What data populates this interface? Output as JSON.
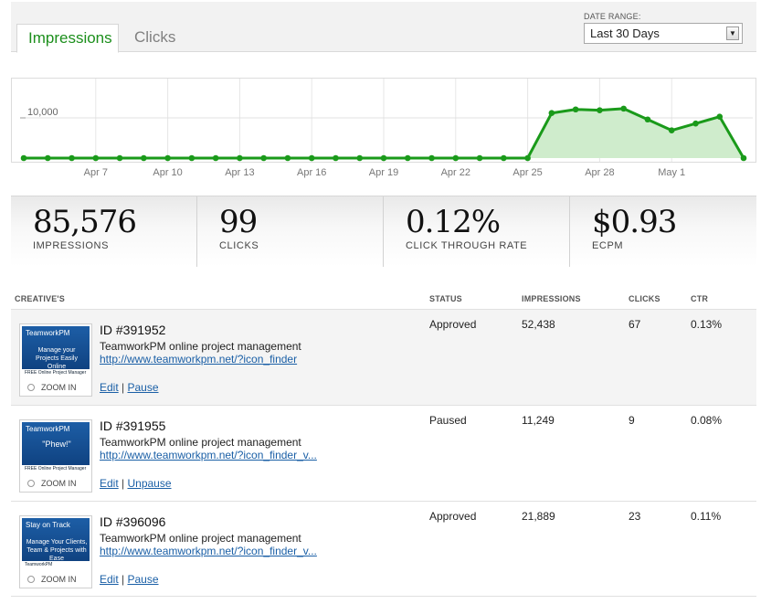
{
  "tabs": [
    {
      "label": "Impressions",
      "active": true
    },
    {
      "label": "Clicks",
      "active": false
    }
  ],
  "date_range": {
    "label": "DATE RANGE:",
    "selected": "Last 30 Days"
  },
  "chart_data": {
    "type": "area",
    "x": [
      "Apr 4",
      "Apr 5",
      "Apr 6",
      "Apr 7",
      "Apr 8",
      "Apr 9",
      "Apr 10",
      "Apr 11",
      "Apr 12",
      "Apr 13",
      "Apr 14",
      "Apr 15",
      "Apr 16",
      "Apr 17",
      "Apr 18",
      "Apr 19",
      "Apr 20",
      "Apr 21",
      "Apr 22",
      "Apr 23",
      "Apr 24",
      "Apr 25",
      "Apr 26",
      "Apr 27",
      "Apr 28",
      "Apr 29",
      "Apr 30",
      "May 1",
      "May 2",
      "May 3",
      "May 4"
    ],
    "tick_labels": [
      "Apr 7",
      "Apr 10",
      "Apr 13",
      "Apr 16",
      "Apr 19",
      "Apr 22",
      "Apr 25",
      "Apr 28",
      "May 1"
    ],
    "values": [
      0,
      0,
      0,
      0,
      0,
      0,
      0,
      0,
      0,
      0,
      0,
      0,
      0,
      0,
      0,
      0,
      0,
      0,
      0,
      0,
      0,
      0,
      11200,
      12100,
      11900,
      12300,
      9600,
      6900,
      8600,
      10300,
      0
    ],
    "y_tick": "10,000",
    "ylim": [
      0,
      20000
    ],
    "colors": {
      "line": "#1a9a1a",
      "fill": "#cfeccc"
    },
    "grid": true
  },
  "stats": [
    {
      "value": "85,576",
      "label": "IMPRESSIONS"
    },
    {
      "value": "99",
      "label": "CLICKS"
    },
    {
      "value": "0.12%",
      "label": "CLICK THROUGH RATE"
    },
    {
      "value": "$0.93",
      "label": "ECPM"
    }
  ],
  "table": {
    "headers": {
      "creatives": "CREATIVE'S",
      "status": "STATUS",
      "impressions": "IMPRESSIONS",
      "clicks": "CLICKS",
      "ctr": "CTR"
    },
    "zoom_label": "ZOOM IN",
    "rows": [
      {
        "id": "ID #391952",
        "desc": "TeamworkPM online project management",
        "url": "http://www.teamworkpm.net/?icon_finder",
        "edit": "Edit",
        "toggle": "Pause",
        "status": "Approved",
        "impressions": "52,438",
        "clicks": "67",
        "ctr": "0.13%",
        "thumb": {
          "brand": "TeamworkPM",
          "tag": "Manage your Projects Easily Online",
          "foot": "FREE Online Project Manager"
        }
      },
      {
        "id": "ID #391955",
        "desc": "TeamworkPM online project management",
        "url": "http://www.teamworkpm.net/?icon_finder_v...",
        "edit": "Edit",
        "toggle": "Unpause",
        "status": "Paused",
        "impressions": "11,249",
        "clicks": "9",
        "ctr": "0.08%",
        "thumb": {
          "brand": "TeamworkPM",
          "tag": "\"Phew!\"",
          "foot": "FREE Online Project Manager"
        }
      },
      {
        "id": "ID #396096",
        "desc": "TeamworkPM online project management",
        "url": "http://www.teamworkpm.net/?icon_finder_v...",
        "edit": "Edit",
        "toggle": "Pause",
        "status": "Approved",
        "impressions": "21,889",
        "clicks": "23",
        "ctr": "0.11%",
        "thumb": {
          "brand": "Stay on Track",
          "tag": "Manage Your Clients, Team & Projects with Ease",
          "foot": "TeamworkPM"
        }
      }
    ]
  }
}
